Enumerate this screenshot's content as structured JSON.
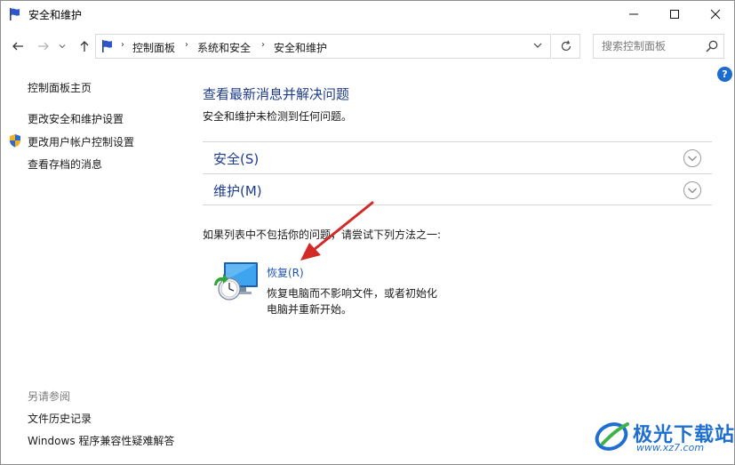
{
  "window": {
    "title": "安全和维护"
  },
  "nav": {
    "breadcrumbs": [
      "控制面板",
      "系统和安全",
      "安全和维护"
    ],
    "search_placeholder": "搜索控制面板"
  },
  "sidebar": {
    "items": [
      {
        "label": "控制面板主页"
      },
      {
        "label": "更改安全和维护设置"
      },
      {
        "label": "更改用户帐户控制设置"
      },
      {
        "label": "查看存档的消息"
      }
    ],
    "see_also_heading": "另请参阅",
    "see_also": [
      {
        "label": "文件历史记录"
      },
      {
        "label": "Windows 程序兼容性疑难解答"
      }
    ]
  },
  "main": {
    "title": "查看最新消息并解决问题",
    "subtitle": "安全和维护未检测到任何问题。",
    "sections": [
      {
        "label": "安全(S)"
      },
      {
        "label": "维护(M)"
      }
    ],
    "hint": "如果列表中不包括你的问题，请尝试下列方法之一:",
    "recovery": {
      "link": "恢复(R)",
      "description": "恢复电脑而不影响文件，或者初始化电脑并重新开始。"
    }
  },
  "watermark": {
    "name": "极光下载站",
    "url": "www.xz7.com"
  },
  "colors": {
    "link": "#1e3c8c",
    "accent": "#1c6ccf"
  },
  "icons": [
    "flag-icon",
    "back-arrow-icon",
    "forward-arrow-icon",
    "up-arrow-icon",
    "refresh-icon",
    "search-icon",
    "help-icon",
    "shield-icon",
    "chevron-down-icon",
    "recovery-icon"
  ]
}
